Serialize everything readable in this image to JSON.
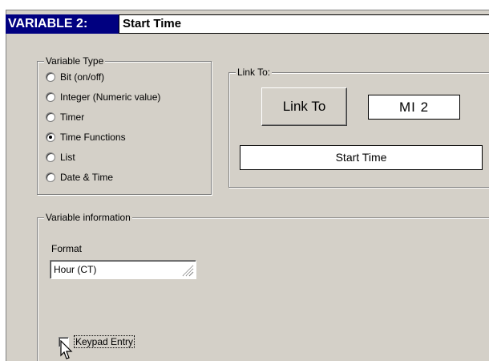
{
  "variable": {
    "header": "VARIABLE 2:",
    "name": "Start Time"
  },
  "variable_type": {
    "title": "Variable Type",
    "options": [
      {
        "label": "Bit (on/off)",
        "selected": false
      },
      {
        "label": "Integer (Numeric value)",
        "selected": false
      },
      {
        "label": "Timer",
        "selected": false
      },
      {
        "label": "Time Functions",
        "selected": true
      },
      {
        "label": "List",
        "selected": false
      },
      {
        "label": "Date & Time",
        "selected": false
      }
    ]
  },
  "link_to": {
    "title": "Link To:",
    "button_label": "Link To",
    "address": "MI 2",
    "description": "Start Time"
  },
  "variable_info": {
    "title": "Variable information",
    "format_label": "Format",
    "format_value": "Hour (CT)",
    "keypad_label": "Keypad Entry",
    "keypad_checked": false
  },
  "icons": {
    "dropdown": "dropdown-grip-icon",
    "cursor": "mouse-pointer-icon"
  }
}
